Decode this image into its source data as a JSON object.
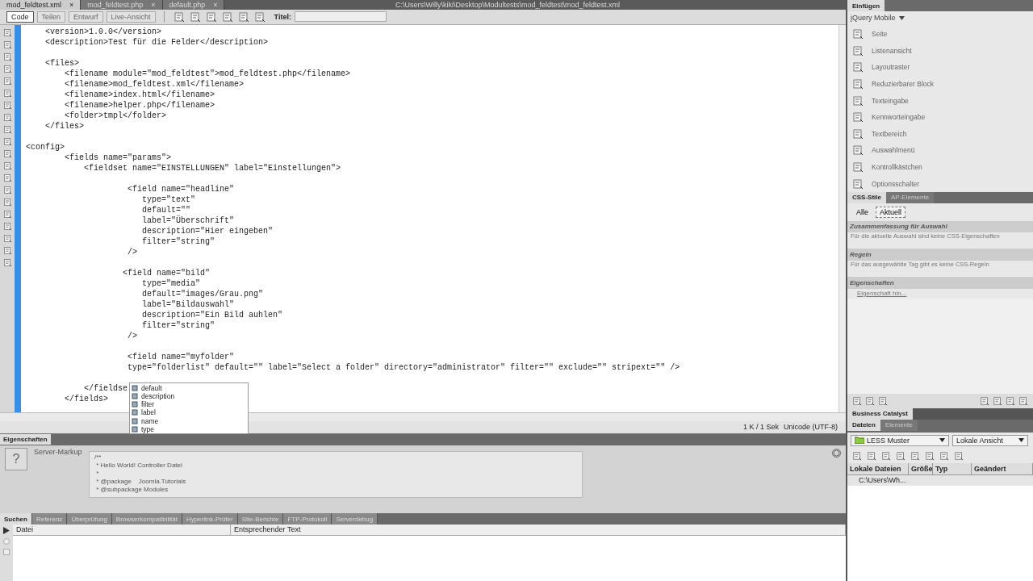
{
  "document_tabs": [
    {
      "label": "mod_feldtest.xml",
      "close": "×",
      "selected": true
    },
    {
      "label": "mod_feldtest.php",
      "close": "×",
      "selected": false
    },
    {
      "label": "default.php",
      "close": "×",
      "selected": false
    }
  ],
  "file_path": "C:\\Users\\Willy\\kiki\\Desktop\\Modultests\\mod_feldtest\\mod_feldtest.xml",
  "toolbar": {
    "views": [
      {
        "label": "Code",
        "selected": true,
        "disabled": false
      },
      {
        "label": "Teilen",
        "selected": false,
        "disabled": true
      },
      {
        "label": "Entwurf",
        "selected": false,
        "disabled": true
      },
      {
        "label": "Live-Ansicht",
        "selected": false,
        "disabled": true
      }
    ],
    "title_label": "Titel:"
  },
  "code": {
    "groups": [
      [
        "    <version>1.0.0</version>",
        "    <description>Test für die Felder</description>"
      ],
      [
        "    <files>",
        "        <filename module=\"mod_feldtest\">mod_feldtest.php</filename>",
        "        <filename>mod_feldtest.xml</filename>",
        "        <filename>index.html</filename>",
        "        <filename>helper.php</filename>",
        "        <folder>tmpl</folder>",
        "    </files>"
      ],
      [
        "<config>",
        "        <fields name=\"params\">",
        "            <fieldset name=\"EINSTELLUNGEN\" label=\"Einstellungen\">"
      ],
      [
        "                     <field name=\"headline\"",
        "                        type=\"text\"",
        "                        default=\"\"",
        "                        label=\"Überschrift\"",
        "                        description=\"Hier eingeben\"",
        "                        filter=\"string\"",
        "                     />"
      ],
      [
        "                    <field name=\"bild\"",
        "                        type=\"media\"",
        "                        default=\"images/Grau.png\"",
        "                        label=\"Bildauswahl\"",
        "                        description=\"Ein Bild auhlen\"",
        "                        filter=\"string\"",
        "                     />"
      ],
      [
        "                     <field name=\"myfolder\"",
        "                     type=\"folderlist\" default=\"\" label=\"Select a folder\" directory=\"administrator\" filter=\"\" exclude=\"\" stripext=\"\" />"
      ],
      [
        "            </fieldse",
        "        </fields>"
      ]
    ],
    "autocomplete": [
      "default",
      "description",
      "filter",
      "label",
      "name",
      "type"
    ]
  },
  "status_bar": {
    "size": "1 K / 1 Sek",
    "encoding": "Unicode (UTF-8)"
  },
  "properties": {
    "tab": "Eigenschaften",
    "label": "Server-Markup",
    "help": "?",
    "lines": [
      "/**",
      " * Hello World! Controller Datei",
      " *",
      " * @package    Joomla.Tutorials",
      " * @subpackage Modules"
    ]
  },
  "results": {
    "tabs": [
      {
        "label": "Suchen",
        "selected": true
      },
      {
        "label": "Referenz",
        "selected": false
      },
      {
        "label": "Überprüfung",
        "selected": false
      },
      {
        "label": "Browserkompatibilität",
        "selected": false
      },
      {
        "label": "Hyperlink-Prüfer",
        "selected": false
      },
      {
        "label": "Site-Berichte",
        "selected": false
      },
      {
        "label": "FTP-Protokoll",
        "selected": false
      },
      {
        "label": "Serverdebug",
        "selected": false
      }
    ],
    "columns": [
      "Datei",
      "Entsprechender Text"
    ]
  },
  "insert_panel": {
    "tab": "Einfügen",
    "category": "jQuery Mobile",
    "items": [
      "Seite",
      "Listenansicht",
      "Layoutraster",
      "Reduzierbarer Block",
      "Texteingabe",
      "Kennworteingabe",
      "Textbereich",
      "Auswahlmenü",
      "Kontrollkästchen",
      "Optionsschalter"
    ]
  },
  "css_panel": {
    "tabs": [
      {
        "label": "CSS-Stile",
        "selected": true
      },
      {
        "label": "AP-Elemente",
        "selected": false
      }
    ],
    "modes": [
      {
        "label": "Alle",
        "selected": false
      },
      {
        "label": "Aktuell",
        "selected": true
      }
    ],
    "summary_title": "Zusammenfassung für Auswahl",
    "summary_text": "Für die aktuelle Auswahl sind keine CSS-Eigenschaften",
    "rules_title": "Regeln",
    "rules_text": "Für das ausgewählte Tag gibt es keine CSS-Regeln",
    "properties_title": "Eigenschaften",
    "add_property": "Eigenschaft hin..."
  },
  "business_catalyst": {
    "tab": "Business Catalyst"
  },
  "files_panel": {
    "tabs": [
      {
        "label": "Dateien",
        "selected": true
      },
      {
        "label": "Elemente",
        "selected": false
      }
    ],
    "site": "LESS Muster",
    "view": "Lokale Ansicht",
    "columns": [
      "Lokale Dateien",
      "Größe",
      "Typ",
      "Geändert"
    ],
    "rows": [
      "C:\\Users\\Wh..."
    ]
  }
}
